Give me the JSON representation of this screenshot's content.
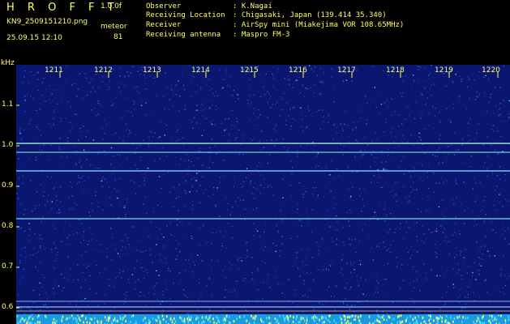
{
  "header": {
    "app_title": "H R O F F T",
    "version": "1.0.0f",
    "filename": "KN9_2509151210.png",
    "timestamp": "25.09.15 12:10",
    "count_label": "meteor",
    "count_value": "81"
  },
  "meta": [
    {
      "key": "Observer",
      "value": ": K.Nagai"
    },
    {
      "key": "Receiving Location",
      "value": ": Chigasaki, Japan (139.414 35.340)"
    },
    {
      "key": "Receiver",
      "value": ": AirSpy mini (Miakejima VOR 108.65MHz)"
    },
    {
      "key": "Receiving antenna",
      "value": ": Maspro FM-3"
    }
  ],
  "axis": {
    "y_unit": "kHz",
    "y_ticks": [
      "1.1",
      "1.0",
      "0.9",
      "0.8",
      "0.7",
      "0.6"
    ],
    "x_ticks": [
      "1211",
      "1212",
      "1213",
      "1214",
      "1215",
      "1216",
      "1217",
      "1218",
      "1219",
      "1220"
    ]
  },
  "colors": {
    "background": "#000000",
    "text": "#ffff66",
    "spectrogram_bg": "#0a1670",
    "signal_line": "#7fffd4"
  }
}
